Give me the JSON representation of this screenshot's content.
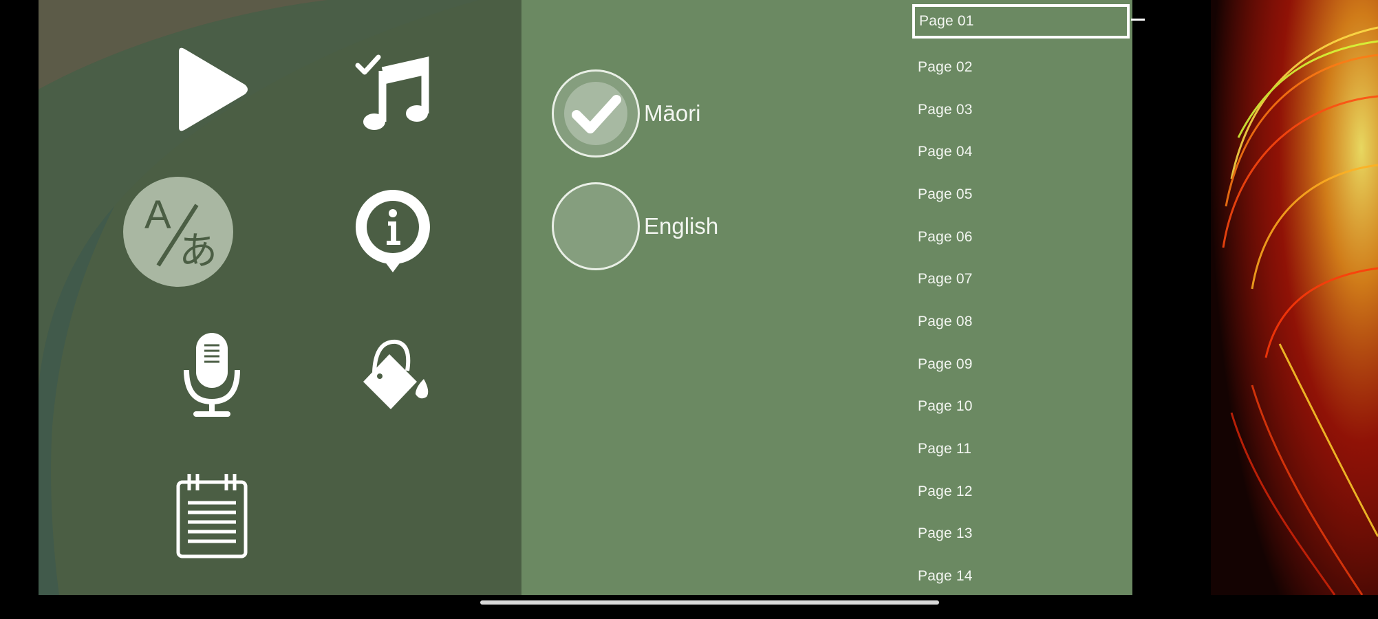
{
  "menu": {
    "buttons": [
      {
        "name": "play-button",
        "icon": "play-icon"
      },
      {
        "name": "music-button",
        "icon": "music-note-check-icon"
      },
      {
        "name": "language-button",
        "icon": "language-translate-icon",
        "active": true
      },
      {
        "name": "info-button",
        "icon": "info-icon"
      },
      {
        "name": "microphone-button",
        "icon": "microphone-icon"
      },
      {
        "name": "paint-bucket-button",
        "icon": "paint-bucket-icon"
      },
      {
        "name": "notepad-button",
        "icon": "notepad-icon"
      }
    ]
  },
  "language": {
    "options": [
      {
        "label": "Māori",
        "checked": true
      },
      {
        "label": "English",
        "checked": false
      }
    ]
  },
  "pages": {
    "items": [
      "Page 01",
      "Page 02",
      "Page 03",
      "Page 04",
      "Page 05",
      "Page 06",
      "Page 07",
      "Page 08",
      "Page 09",
      "Page 10",
      "Page 11",
      "Page 12",
      "Page 13",
      "Page 14"
    ],
    "selected": "Page 01"
  },
  "colors": {
    "menu_panel": "#4b5e44",
    "language_panel": "#6b8962",
    "text": "#f3f6f1"
  }
}
